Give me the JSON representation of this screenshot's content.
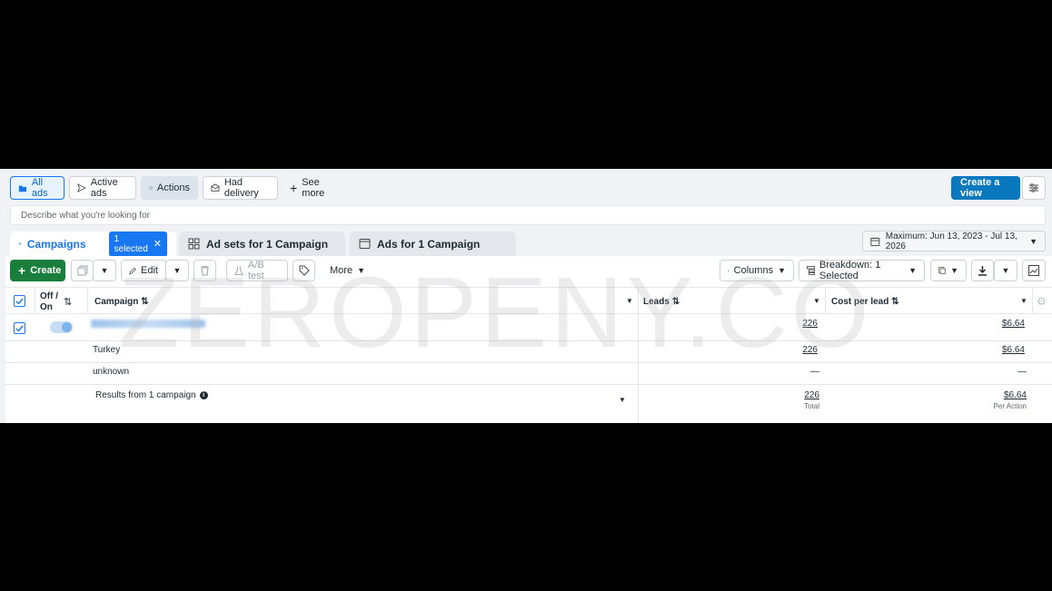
{
  "filters": {
    "all_ads": "All ads",
    "active_ads": "Active ads",
    "actions": "Actions",
    "had_delivery": "Had delivery",
    "see_more": "See more",
    "create_view": "Create a view"
  },
  "search": {
    "placeholder": "Describe what you're looking for"
  },
  "tabs": {
    "campaigns": "Campaigns",
    "selected_badge": "1 selected",
    "ad_sets": "Ad sets for 1 Campaign",
    "ads": "Ads for 1 Campaign"
  },
  "date_range": "Maximum: Jun 13, 2023 - Jul 13, 2026",
  "toolbar": {
    "create": "Create",
    "edit": "Edit",
    "ab_test": "A/B test",
    "more": "More",
    "columns": "Columns",
    "breakdown": "Breakdown: 1 Selected"
  },
  "table": {
    "headers": {
      "off_on_line1": "Off /",
      "off_on_line2": "On",
      "campaign": "Campaign",
      "leads": "Leads",
      "cost_per_lead": "Cost per lead"
    },
    "rows": [
      {
        "label": "",
        "leads": "226",
        "cost": "$6.64"
      },
      {
        "label": "Turkey",
        "leads": "226",
        "cost": "$6.64"
      },
      {
        "label": "unknown",
        "leads": "—",
        "cost": "—"
      }
    ],
    "summary": {
      "label": "Results from 1 campaign",
      "leads": "226",
      "leads_sub": "Total",
      "cost": "$6.64",
      "cost_sub": "Per Action"
    }
  },
  "watermark": "ZEROPENY.CO",
  "colors": {
    "primary": "#0a78be",
    "create": "#1a7f3c",
    "accent": "#1877f2"
  }
}
